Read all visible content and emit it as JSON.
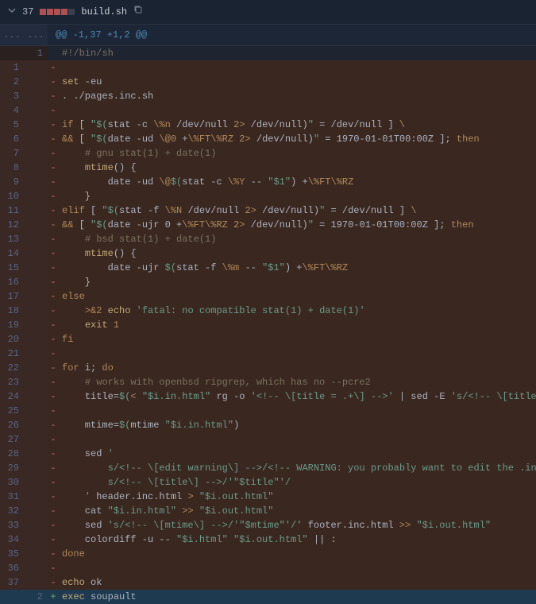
{
  "file": {
    "change_count": "37",
    "filename": "build.sh"
  },
  "hunk": "@@ -1,37 +1,2 @@",
  "ellipsis": "...",
  "lines": [
    {
      "old": "",
      "new": "1",
      "type": "ctx",
      "tokens": [
        {
          "t": "#!/bin/sh",
          "c": "c-comment"
        }
      ]
    },
    {
      "old": "1",
      "new": "",
      "type": "del",
      "tokens": []
    },
    {
      "old": "2",
      "new": "",
      "type": "del",
      "tokens": [
        {
          "t": "set",
          "c": "c-cmd"
        },
        {
          "t": " -eu",
          "c": ""
        }
      ]
    },
    {
      "old": "3",
      "new": "",
      "type": "del",
      "tokens": [
        {
          "t": ". ./pages.inc.sh",
          "c": ""
        }
      ]
    },
    {
      "old": "4",
      "new": "",
      "type": "del",
      "tokens": []
    },
    {
      "old": "5",
      "new": "",
      "type": "del",
      "tokens": [
        {
          "t": "if",
          "c": "c-keyword"
        },
        {
          "t": " [ ",
          "c": ""
        },
        {
          "t": "\"$(",
          "c": "c-string"
        },
        {
          "t": "stat -c ",
          "c": ""
        },
        {
          "t": "\\%n",
          "c": "c-op"
        },
        {
          "t": " /dev/null ",
          "c": ""
        },
        {
          "t": "2>",
          "c": "c-op"
        },
        {
          "t": " /dev/null)",
          "c": ""
        },
        {
          "t": "\"",
          "c": "c-string"
        },
        {
          "t": " = /dev/null ] ",
          "c": ""
        },
        {
          "t": "\\",
          "c": "c-op"
        }
      ]
    },
    {
      "old": "6",
      "new": "",
      "type": "del",
      "tokens": [
        {
          "t": "&&",
          "c": "c-op"
        },
        {
          "t": " [ ",
          "c": ""
        },
        {
          "t": "\"$(",
          "c": "c-string"
        },
        {
          "t": "date -ud ",
          "c": ""
        },
        {
          "t": "\\@0",
          "c": "c-op"
        },
        {
          "t": " +",
          "c": ""
        },
        {
          "t": "\\%FT\\%RZ",
          "c": "c-op"
        },
        {
          "t": " ",
          "c": ""
        },
        {
          "t": "2>",
          "c": "c-op"
        },
        {
          "t": " /dev/null)",
          "c": ""
        },
        {
          "t": "\"",
          "c": "c-string"
        },
        {
          "t": " = 1970-01-01T00:00Z ]; ",
          "c": ""
        },
        {
          "t": "then",
          "c": "c-keyword"
        }
      ]
    },
    {
      "old": "7",
      "new": "",
      "type": "del",
      "tokens": [
        {
          "t": "    ",
          "c": ""
        },
        {
          "t": "# gnu stat(1) + date(1)",
          "c": "c-comment"
        }
      ]
    },
    {
      "old": "8",
      "new": "",
      "type": "del",
      "tokens": [
        {
          "t": "    ",
          "c": ""
        },
        {
          "t": "mtime",
          "c": "c-cmd"
        },
        {
          "t": "() {",
          "c": ""
        }
      ]
    },
    {
      "old": "9",
      "new": "",
      "type": "del",
      "tokens": [
        {
          "t": "        date -ud ",
          "c": ""
        },
        {
          "t": "\\@",
          "c": "c-op"
        },
        {
          "t": "$(",
          "c": "c-string"
        },
        {
          "t": "stat -c ",
          "c": ""
        },
        {
          "t": "\\%Y",
          "c": "c-op"
        },
        {
          "t": " -- ",
          "c": ""
        },
        {
          "t": "\"$1\"",
          "c": "c-string"
        },
        {
          "t": ") +",
          "c": ""
        },
        {
          "t": "\\%FT\\%RZ",
          "c": "c-op"
        }
      ]
    },
    {
      "old": "10",
      "new": "",
      "type": "del",
      "tokens": [
        {
          "t": "    }",
          "c": ""
        }
      ]
    },
    {
      "old": "11",
      "new": "",
      "type": "del",
      "tokens": [
        {
          "t": "elif",
          "c": "c-keyword"
        },
        {
          "t": " [ ",
          "c": ""
        },
        {
          "t": "\"$(",
          "c": "c-string"
        },
        {
          "t": "stat -f ",
          "c": ""
        },
        {
          "t": "\\%N",
          "c": "c-op"
        },
        {
          "t": " /dev/null ",
          "c": ""
        },
        {
          "t": "2>",
          "c": "c-op"
        },
        {
          "t": " /dev/null)",
          "c": ""
        },
        {
          "t": "\"",
          "c": "c-string"
        },
        {
          "t": " = /dev/null ] ",
          "c": ""
        },
        {
          "t": "\\",
          "c": "c-op"
        }
      ]
    },
    {
      "old": "12",
      "new": "",
      "type": "del",
      "tokens": [
        {
          "t": "&&",
          "c": "c-op"
        },
        {
          "t": " [ ",
          "c": ""
        },
        {
          "t": "\"$(",
          "c": "c-string"
        },
        {
          "t": "date -ujr 0 +",
          "c": ""
        },
        {
          "t": "\\%FT\\%RZ",
          "c": "c-op"
        },
        {
          "t": " ",
          "c": ""
        },
        {
          "t": "2>",
          "c": "c-op"
        },
        {
          "t": " /dev/null)",
          "c": ""
        },
        {
          "t": "\"",
          "c": "c-string"
        },
        {
          "t": " = 1970-01-01T00:00Z ]; ",
          "c": ""
        },
        {
          "t": "then",
          "c": "c-keyword"
        }
      ]
    },
    {
      "old": "13",
      "new": "",
      "type": "del",
      "tokens": [
        {
          "t": "    ",
          "c": ""
        },
        {
          "t": "# bsd stat(1) + date(1)",
          "c": "c-comment"
        }
      ]
    },
    {
      "old": "14",
      "new": "",
      "type": "del",
      "tokens": [
        {
          "t": "    ",
          "c": ""
        },
        {
          "t": "mtime",
          "c": "c-cmd"
        },
        {
          "t": "() {",
          "c": ""
        }
      ]
    },
    {
      "old": "15",
      "new": "",
      "type": "del",
      "tokens": [
        {
          "t": "        date -ujr ",
          "c": ""
        },
        {
          "t": "$(",
          "c": "c-string"
        },
        {
          "t": "stat -f ",
          "c": ""
        },
        {
          "t": "\\%m",
          "c": "c-op"
        },
        {
          "t": " -- ",
          "c": ""
        },
        {
          "t": "\"$1\"",
          "c": "c-string"
        },
        {
          "t": ") +",
          "c": ""
        },
        {
          "t": "\\%FT\\%RZ",
          "c": "c-op"
        }
      ]
    },
    {
      "old": "16",
      "new": "",
      "type": "del",
      "tokens": [
        {
          "t": "    }",
          "c": ""
        }
      ]
    },
    {
      "old": "17",
      "new": "",
      "type": "del",
      "tokens": [
        {
          "t": "else",
          "c": "c-keyword"
        }
      ]
    },
    {
      "old": "18",
      "new": "",
      "type": "del",
      "tokens": [
        {
          "t": "    ",
          "c": ""
        },
        {
          "t": ">&2",
          "c": "c-op"
        },
        {
          "t": " ",
          "c": ""
        },
        {
          "t": "echo",
          "c": "c-cmd"
        },
        {
          "t": " ",
          "c": ""
        },
        {
          "t": "'fatal: no compatible stat(1) + date(1)'",
          "c": "c-string"
        }
      ]
    },
    {
      "old": "19",
      "new": "",
      "type": "del",
      "tokens": [
        {
          "t": "    ",
          "c": ""
        },
        {
          "t": "exit",
          "c": "c-cmd"
        },
        {
          "t": " ",
          "c": ""
        },
        {
          "t": "1",
          "c": "c-num"
        }
      ]
    },
    {
      "old": "20",
      "new": "",
      "type": "del",
      "tokens": [
        {
          "t": "fi",
          "c": "c-keyword"
        }
      ]
    },
    {
      "old": "21",
      "new": "",
      "type": "del",
      "tokens": []
    },
    {
      "old": "22",
      "new": "",
      "type": "del",
      "tokens": [
        {
          "t": "for",
          "c": "c-keyword"
        },
        {
          "t": " i; ",
          "c": ""
        },
        {
          "t": "do",
          "c": "c-keyword"
        }
      ]
    },
    {
      "old": "23",
      "new": "",
      "type": "del",
      "tokens": [
        {
          "t": "    ",
          "c": ""
        },
        {
          "t": "# works with openbsd ripgrep, which has no --pcre2",
          "c": "c-comment"
        }
      ]
    },
    {
      "old": "24",
      "new": "",
      "type": "del",
      "tokens": [
        {
          "t": "    title=",
          "c": ""
        },
        {
          "t": "$(",
          "c": "c-string"
        },
        {
          "t": "< ",
          "c": "c-op"
        },
        {
          "t": "\"$i.in.html\"",
          "c": "c-string"
        },
        {
          "t": " rg -o ",
          "c": ""
        },
        {
          "t": "'<!-- \\[title = .+\\] -->'",
          "c": "c-string"
        },
        {
          "t": " | sed -E ",
          "c": ""
        },
        {
          "t": "'s/<!-- \\[title = |\\] -->$//g'",
          "c": "c-string"
        },
        {
          "t": ")",
          "c": ""
        }
      ]
    },
    {
      "old": "25",
      "new": "",
      "type": "del",
      "tokens": []
    },
    {
      "old": "26",
      "new": "",
      "type": "del",
      "tokens": [
        {
          "t": "    mtime=",
          "c": ""
        },
        {
          "t": "$(",
          "c": "c-string"
        },
        {
          "t": "mtime ",
          "c": ""
        },
        {
          "t": "\"$i.in.html\"",
          "c": "c-string"
        },
        {
          "t": ")",
          "c": ""
        }
      ]
    },
    {
      "old": "27",
      "new": "",
      "type": "del",
      "tokens": []
    },
    {
      "old": "28",
      "new": "",
      "type": "del",
      "tokens": [
        {
          "t": "    sed ",
          "c": ""
        },
        {
          "t": "'",
          "c": "c-string"
        }
      ]
    },
    {
      "old": "29",
      "new": "",
      "type": "del",
      "tokens": [
        {
          "t": "        s/<!-- \\[edit warning\\] -->/<!-- WARNING: you probably want to edit the .in.html, not this file! -->/",
          "c": "c-string"
        }
      ]
    },
    {
      "old": "30",
      "new": "",
      "type": "del",
      "tokens": [
        {
          "t": "        s/<!-- \\[title\\] -->/'",
          "c": "c-string"
        },
        {
          "t": "\"$title\"",
          "c": "c-string"
        },
        {
          "t": "'/",
          "c": "c-string"
        }
      ]
    },
    {
      "old": "31",
      "new": "",
      "type": "del",
      "tokens": [
        {
          "t": "    '",
          "c": "c-string"
        },
        {
          "t": " header.inc.html ",
          "c": ""
        },
        {
          "t": ">",
          "c": "c-op"
        },
        {
          "t": " ",
          "c": ""
        },
        {
          "t": "\"$i.out.html\"",
          "c": "c-string"
        }
      ]
    },
    {
      "old": "32",
      "new": "",
      "type": "del",
      "tokens": [
        {
          "t": "    cat ",
          "c": ""
        },
        {
          "t": "\"$i.in.html\"",
          "c": "c-string"
        },
        {
          "t": " ",
          "c": ""
        },
        {
          "t": ">>",
          "c": "c-op"
        },
        {
          "t": " ",
          "c": ""
        },
        {
          "t": "\"$i.out.html\"",
          "c": "c-string"
        }
      ]
    },
    {
      "old": "33",
      "new": "",
      "type": "del",
      "tokens": [
        {
          "t": "    sed ",
          "c": ""
        },
        {
          "t": "'s/<!-- \\[mtime\\] -->/'",
          "c": "c-string"
        },
        {
          "t": "\"$mtime\"",
          "c": "c-string"
        },
        {
          "t": "'/'",
          "c": "c-string"
        },
        {
          "t": " footer.inc.html ",
          "c": ""
        },
        {
          "t": ">>",
          "c": "c-op"
        },
        {
          "t": " ",
          "c": ""
        },
        {
          "t": "\"$i.out.html\"",
          "c": "c-string"
        }
      ]
    },
    {
      "old": "34",
      "new": "",
      "type": "del",
      "tokens": [
        {
          "t": "    colordiff -u -- ",
          "c": ""
        },
        {
          "t": "\"$i.html\"",
          "c": "c-string"
        },
        {
          "t": " ",
          "c": ""
        },
        {
          "t": "\"$i.out.html\"",
          "c": "c-string"
        },
        {
          "t": " || :",
          "c": ""
        }
      ]
    },
    {
      "old": "35",
      "new": "",
      "type": "del",
      "tokens": [
        {
          "t": "done",
          "c": "c-keyword"
        }
      ]
    },
    {
      "old": "36",
      "new": "",
      "type": "del",
      "tokens": []
    },
    {
      "old": "37",
      "new": "",
      "type": "del",
      "tokens": [
        {
          "t": "echo",
          "c": "c-cmd"
        },
        {
          "t": " ok",
          "c": ""
        }
      ]
    },
    {
      "old": "",
      "new": "2",
      "type": "add",
      "tokens": [
        {
          "t": "exec",
          "c": "c-cmd"
        },
        {
          "t": " soupault",
          "c": ""
        }
      ]
    }
  ]
}
